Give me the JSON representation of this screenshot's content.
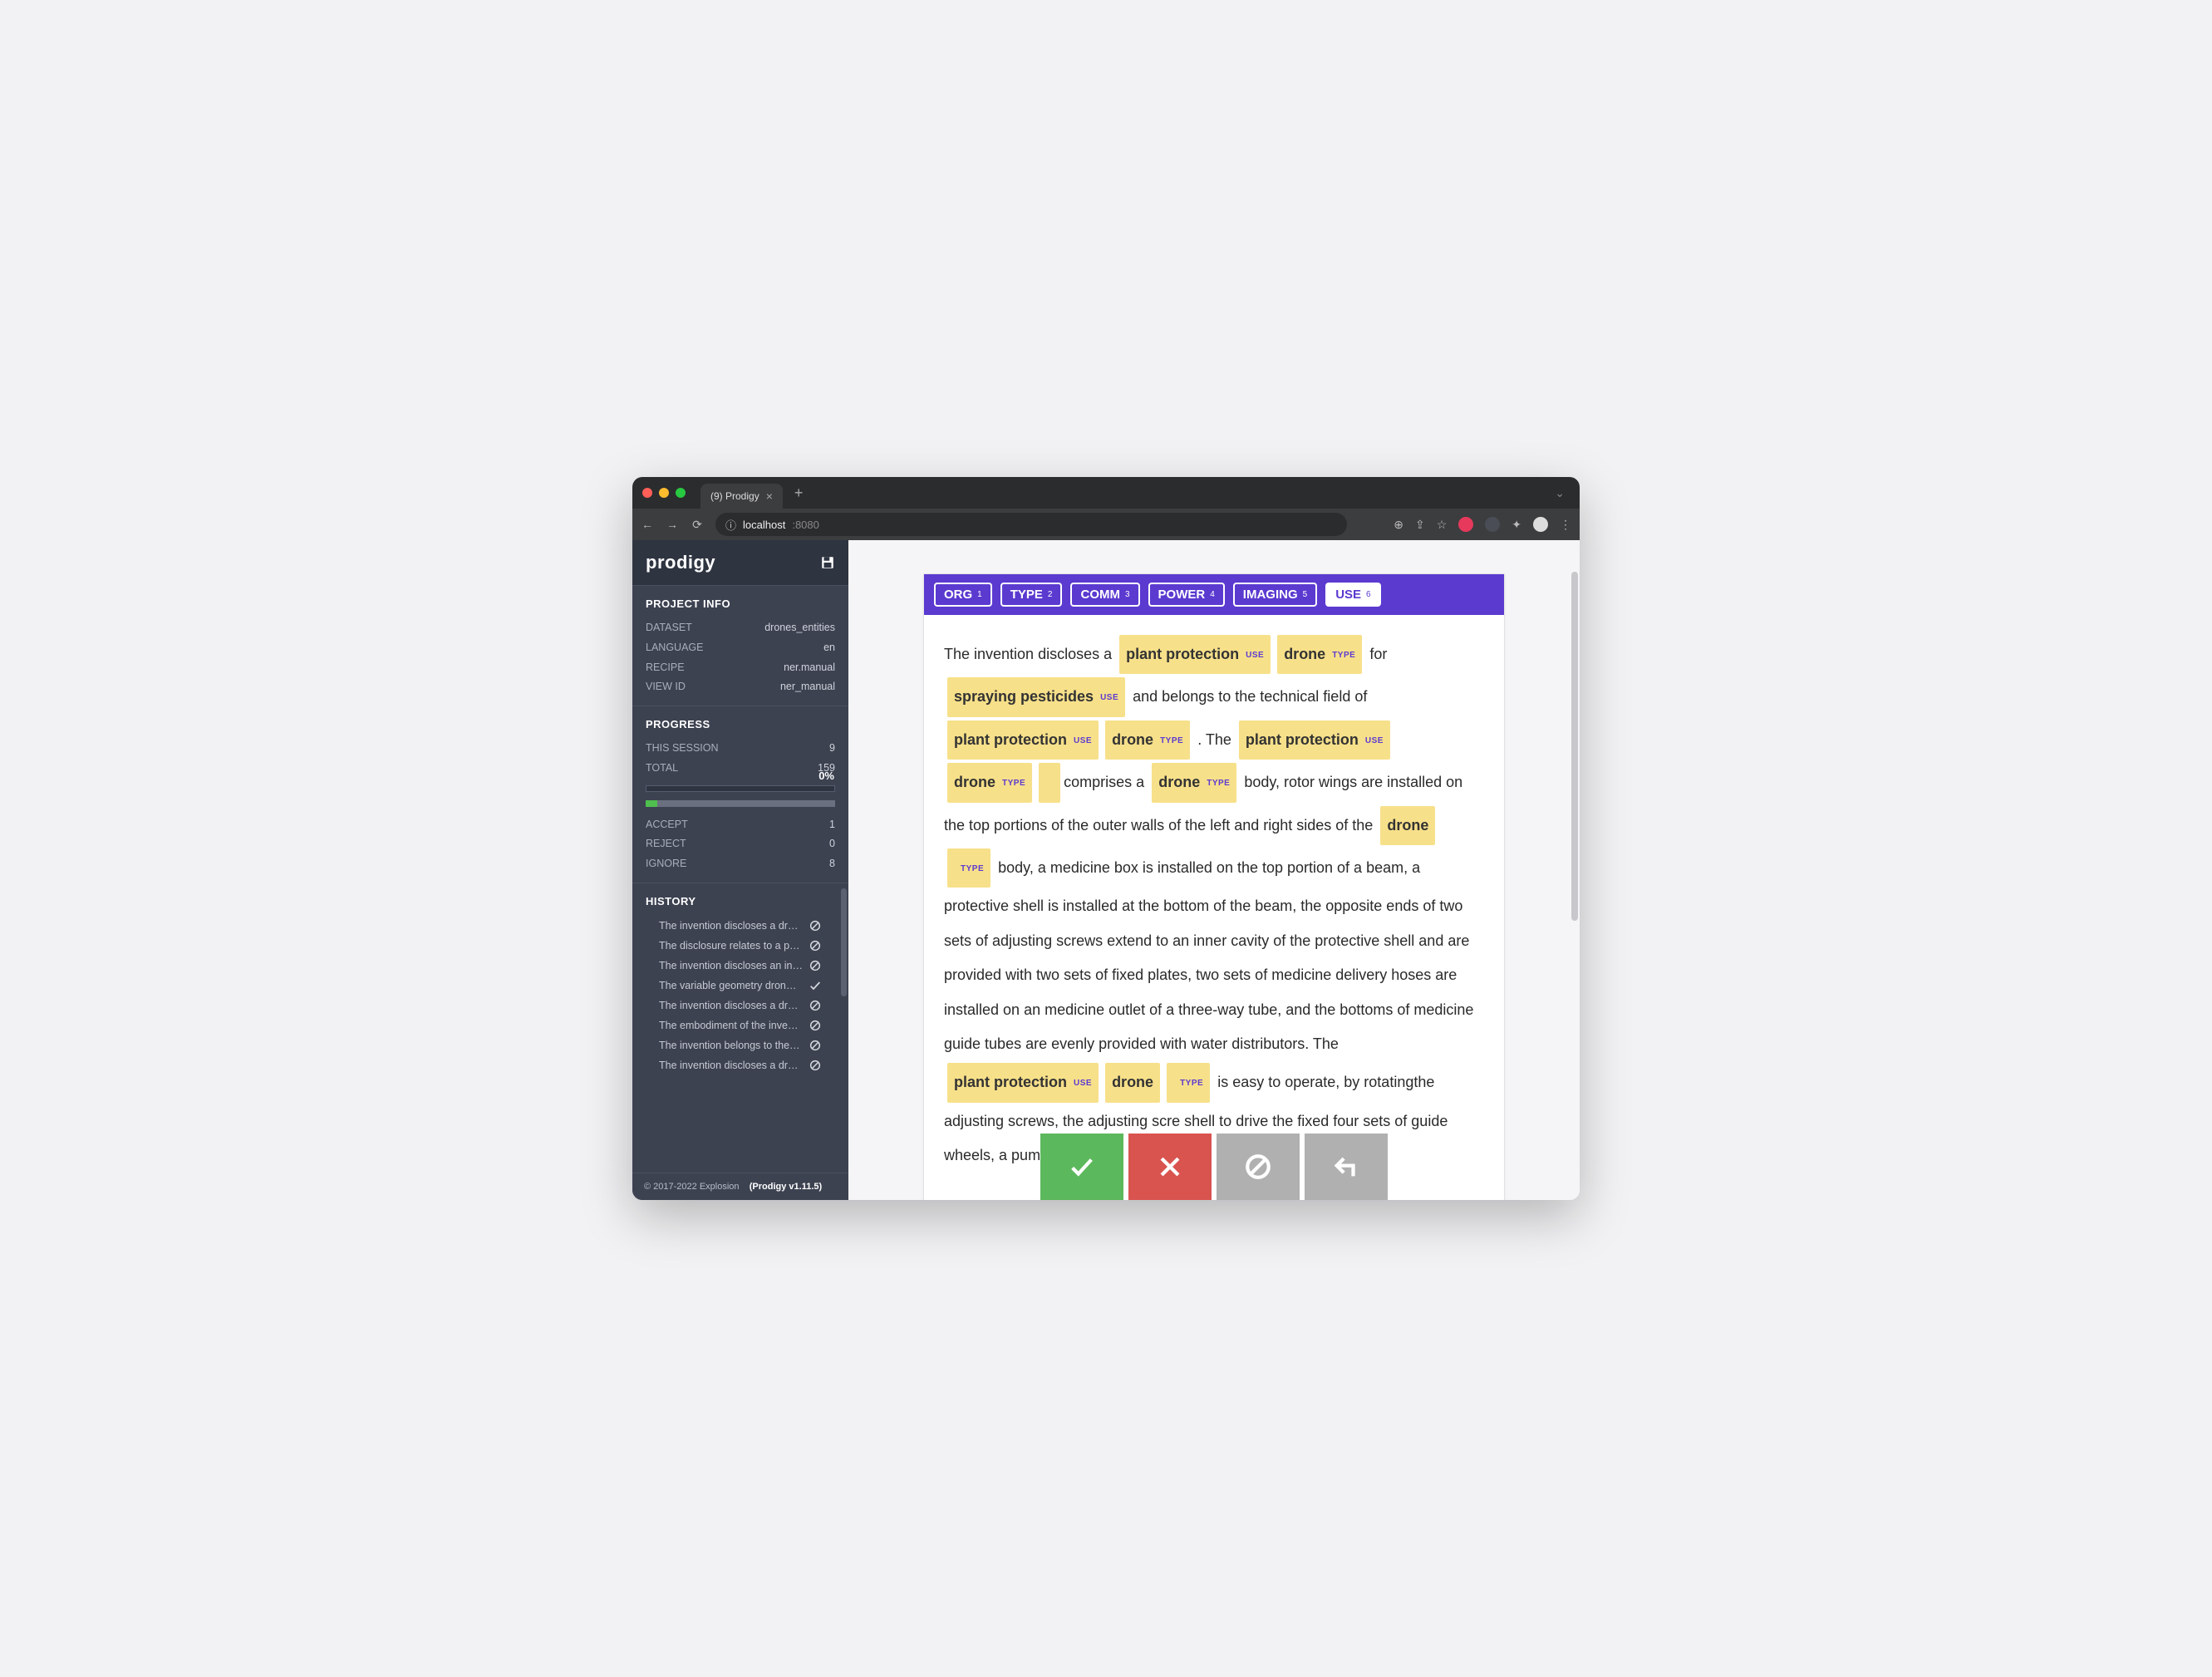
{
  "browser": {
    "tab_title": "(9) Prodigy",
    "url_host": "localhost",
    "url_port": ":8080"
  },
  "app": {
    "brand": "prodigy",
    "footer_copyright": "© 2017-2022 Explosion",
    "footer_product": "(Prodigy v1.11.5)"
  },
  "project_info": {
    "title": "PROJECT INFO",
    "rows": [
      {
        "k": "DATASET",
        "v": "drones_entities"
      },
      {
        "k": "LANGUAGE",
        "v": "en"
      },
      {
        "k": "RECIPE",
        "v": "ner.manual"
      },
      {
        "k": "VIEW ID",
        "v": "ner_manual"
      }
    ]
  },
  "progress": {
    "title": "PROGRESS",
    "rows_top": [
      {
        "k": "THIS SESSION",
        "v": "9"
      },
      {
        "k": "TOTAL",
        "v": "159"
      }
    ],
    "percent_label": "0%",
    "rows_bot": [
      {
        "k": "ACCEPT",
        "v": "1"
      },
      {
        "k": "REJECT",
        "v": "0"
      },
      {
        "k": "IGNORE",
        "v": "8"
      }
    ]
  },
  "history": {
    "title": "HISTORY",
    "items": [
      {
        "txt": "The invention discloses a dr…",
        "status": "ignore"
      },
      {
        "txt": "The disclosure relates to a p…",
        "status": "ignore"
      },
      {
        "txt": "The invention discloses an in…",
        "status": "ignore"
      },
      {
        "txt": "The variable geometry dron…",
        "status": "accept"
      },
      {
        "txt": "The invention discloses a dr…",
        "status": "ignore"
      },
      {
        "txt": "The embodiment of the inve…",
        "status": "ignore"
      },
      {
        "txt": "The invention belongs to the…",
        "status": "ignore"
      },
      {
        "txt": "The invention discloses a dr…",
        "status": "ignore"
      }
    ]
  },
  "labels": [
    {
      "name": "ORG",
      "key": "1",
      "active": false
    },
    {
      "name": "TYPE",
      "key": "2",
      "active": false
    },
    {
      "name": "COMM",
      "key": "3",
      "active": false
    },
    {
      "name": "POWER",
      "key": "4",
      "active": false
    },
    {
      "name": "IMAGING",
      "key": "5",
      "active": false
    },
    {
      "name": "USE",
      "key": "6",
      "active": true
    }
  ],
  "doc": {
    "tokens": [
      {
        "t": "The invention discloses a "
      },
      {
        "span": "plant protection",
        "tag": "USE"
      },
      {
        "span": "drone",
        "tag": "TYPE"
      },
      {
        "t": " for "
      },
      {
        "span": "spraying pesticides",
        "tag": "USE"
      },
      {
        "t": " and belongs to the technical field of "
      },
      {
        "span": "plant protection",
        "tag": "USE"
      },
      {
        "span": "drone",
        "tag": "TYPE"
      },
      {
        "t": " . The "
      },
      {
        "span": "plant protection",
        "tag": "USE"
      },
      {
        "span": "drone",
        "tag": "TYPE"
      },
      {
        "spanTagOnly": "",
        "tag": ""
      },
      {
        "t": "comprises a "
      },
      {
        "span": "drone",
        "tag": "TYPE"
      },
      {
        "t": " body, rotor wings are installed on the top portions of the outer walls of the left and right sides of the "
      },
      {
        "span": "drone",
        "tag": ""
      },
      {
        "spanTagOnly": "TYPE",
        "tag": "TYPE"
      },
      {
        "t": " body, a medicine box is installed on the top portion of a beam, a protective shell is installed at the bottom of the beam, the opposite ends of two sets of adjusting screws extend to an inner cavity of the protective shell and are provided with two sets of fixed plates, two sets of medicine delivery hoses are installed on an medicine outlet of a three-way tube, and the bottoms of medicine guide tubes are evenly provided with water distributors. The "
      },
      {
        "span": "plant protection",
        "tag": "USE"
      },
      {
        "span": "drone",
        "tag": ""
      },
      {
        "spanTagOnly": "TYPE",
        "tag": "TYPE"
      },
      {
        "t": " is easy to operate, by rotatingthe adjusting screws, the adjusting scre"
      },
      {
        "t": "                                                                       shell to drive the fixed                                                                       four sets of guide wheels,                                                                       a pump to"
      }
    ]
  }
}
